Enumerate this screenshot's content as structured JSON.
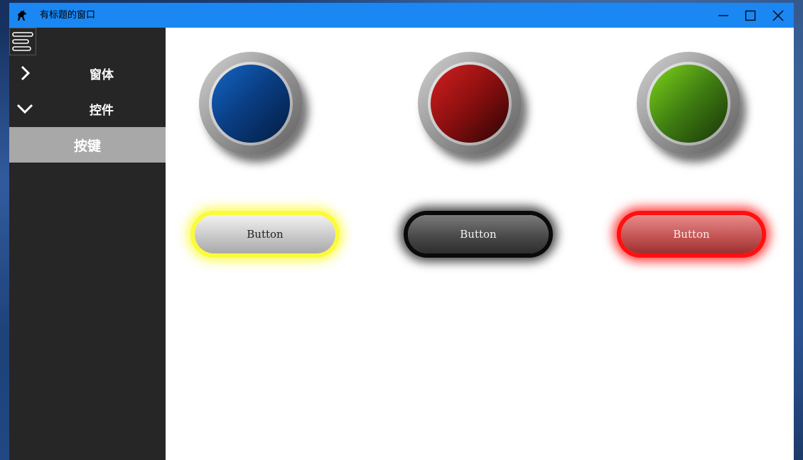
{
  "window": {
    "title": "有标题的窗口",
    "app_icon": "horse-icon",
    "controls": [
      "minimize-icon",
      "maximize-icon",
      "close-icon"
    ],
    "titlebar_color": "#1a87f2"
  },
  "sidebar": {
    "menu_icon": "hamburger-menu-icon",
    "items": [
      {
        "label": "窗体",
        "icon": "chevron-right-icon",
        "state": "collapsed"
      },
      {
        "label": "控件",
        "icon": "chevron-down-icon",
        "state": "expanded"
      },
      {
        "label": "按键",
        "state": "selected"
      }
    ],
    "background": "#262626",
    "selected_background": "#a8a8a8"
  },
  "main": {
    "round_buttons": [
      {
        "color": "blue",
        "from": "#1566c6",
        "to": "#021c40"
      },
      {
        "color": "red",
        "from": "#d42020",
        "to": "#2a0404"
      },
      {
        "color": "green",
        "from": "#7fd41a",
        "to": "#183308"
      }
    ],
    "pill_buttons": [
      {
        "label": "Button",
        "glow": "yellow",
        "glow_color": "#fbfb3a"
      },
      {
        "label": "Button",
        "glow": "black",
        "glow_color": "#0a0a0a"
      },
      {
        "label": "Button",
        "glow": "red",
        "glow_color": "#ff1010"
      }
    ]
  }
}
